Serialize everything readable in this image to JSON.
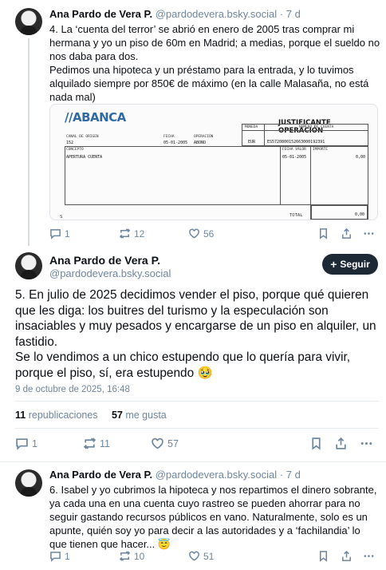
{
  "post1": {
    "name": "Ana Pardo de Vera P.",
    "handle": "@pardodevera.bsky.social",
    "dot": "·",
    "time": "7 d",
    "text_p1": "4. La ‘cuenta del terror’ se abrió en enero de 2005 tras comprar mi hermana y yo un piso de 60m en Madrid; a medias, porque el sueldo no nos daba para dos.",
    "text_p2": "Pedimos una hipoteca y un préstamo para la entrada, y lo tuvimos alquilado siempre por 850€ de máximo (en la calle Malasaña, no está nada mal)",
    "replies": "1",
    "reposts": "12",
    "likes": "56"
  },
  "receipt": {
    "logo": "//ABANCA",
    "title": "JUSTIFICANTE OPERACIÓN",
    "moneda_label": "MONEDA",
    "numero_label": "NÚMERO DE CUENTA",
    "moneda_value": "EUR",
    "numero_value": "ES5720800152663000192391",
    "canal_label": "CANAL DE ORIGEN",
    "canal_value": "152",
    "fecha_label": "FECHA",
    "fecha_value": "05-01-2005",
    "operacion_label": "OPERACIÓN",
    "operacion_value": "ABONO",
    "concepto_label": "CONCEPTO",
    "concepto_value": "APERTURA CUENTA",
    "fecha_valor_label": "FECHA VALOR",
    "fecha_valor_value": "05-01-2005",
    "importe_label": "IMPORTE",
    "importe_value": "0,00",
    "total_label": "TOTAL",
    "total_value": "0,00",
    "footer_mark": "S"
  },
  "post2": {
    "name": "Ana Pardo de Vera P.",
    "handle": "@pardodevera.bsky.social",
    "follow_label": "Seguir",
    "text_p1": "5. En julio de 2025 decidimos vender el piso, porque qué quieren que les diga: los buitres del turismo y la especulación son insaciables y muy pesados y encargarse de un piso en alquiler, un fastidio.",
    "text_p2": "Se lo vendimos a un chico estupendo que lo quería para vivir, porque el piso, sí, era estupendo 🥹",
    "date": "9 de octubre de 2025, 16:48",
    "reposts_count": "11",
    "reposts_label": "republicaciones",
    "likes_count": "57",
    "likes_label": "me gusta",
    "replies": "1",
    "reposts": "11",
    "likes": "57"
  },
  "post3": {
    "name": "Ana Pardo de Vera P.",
    "handle": "@pardodevera.bsky.social",
    "dot": "·",
    "time": "7 d",
    "text": "6. Isabel y yo cubrimos la hipoteca y nos repartimos el dinero sobrante, ya cada una en una cuenta cuyo rastreo se pueden ahorrar para no seguir gastando recursos públicos en vano. Naturalmente, solo es un apunte, quién soy yo para decir a las autoridades y a ‘fachilandia’ lo que tienen que hacer... 😇",
    "replies": "1",
    "reposts": "10",
    "likes": "51"
  },
  "icons": {
    "reply": "reply-icon",
    "repost": "repost-icon",
    "like": "heart-icon",
    "bookmark": "bookmark-icon",
    "share": "share-icon",
    "more": "more-icon"
  }
}
